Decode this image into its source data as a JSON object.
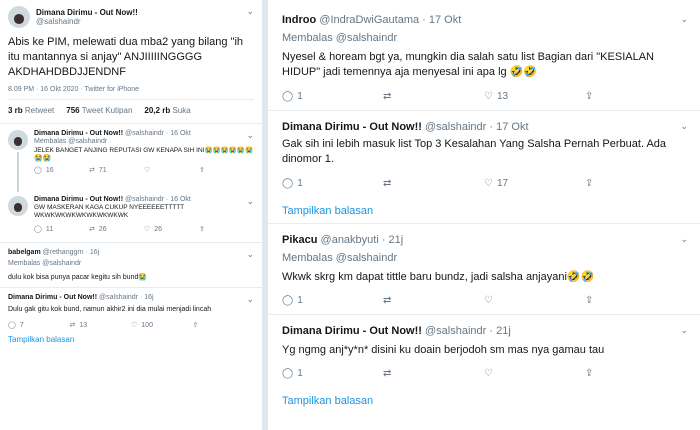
{
  "left": {
    "main": {
      "name": "Dimana Dirimu - Out Now!!",
      "handle": "@salshaindr",
      "text": "Abis ke PIM, melewati dua mba2 yang bilang \"ih itu mantannya si anjay\" ANJIIIIINGGGG AKDHAHDBDJJENDNF",
      "meta": "8.09 PM · 16 Okt 2020 · Twitter for iPhone",
      "stats": [
        {
          "value": "3 rb",
          "label": "Retweet"
        },
        {
          "value": "756",
          "label": "Tweet Kutipan"
        },
        {
          "value": "20,2 rb",
          "label": "Suka"
        }
      ]
    },
    "replies": [
      {
        "name": "Dimana Dirimu - Out Now!!",
        "handle": "@salshaindr · 16 Okt",
        "reply_to": "Membalas @salshaindr",
        "text": "JELEK BANGET ANJING REPUTASI GW KENAPA SIH INI😭😭😭😭😭😭",
        "text2": "😭😭",
        "reply": "16",
        "rt": "71",
        "like": ""
      },
      {
        "name": "Dimana Dirimu - Out Now!!",
        "handle": "@salshaindr · 16 Okt",
        "text": "GW MASKERAN KAGA CUKUP NYEEEEEETTTTT WKWKWKWKWKWKWKWKWK",
        "reply": "11",
        "rt": "26",
        "like": "26"
      },
      {
        "name": "babelgam",
        "handle": "@rethanggrn · 16j",
        "reply_to": "Membalas @salshaindr",
        "text": "dulu kok bisa punya pacar kegitu sih bund😭"
      },
      {
        "name": "Dimana Dirimu - Out Now!!",
        "handle": "@salshaindr · 16j",
        "text": "Dulu gak gitu kok bund, namun akhir2 ini dia mulai menjadi lincah",
        "reply": "7",
        "rt": "13",
        "like": "100"
      }
    ],
    "show_replies": "Tampilkan balasan"
  },
  "right": {
    "tweets": [
      {
        "name": "Indroo",
        "handle": "@IndraDwiGautama · 17 Okt",
        "reply_to": "Membalas @salshaindr",
        "text": "Nyesel & hoream bgt ya, mungkin dia salah satu list Bagian dari  \"KESIALAN HIDUP\"  jadi temennya aja menyesal ini apa lg 🤣🤣",
        "reply": "1",
        "rt": "",
        "like": "13"
      },
      {
        "name": "Dimana Dirimu - Out Now!!",
        "handle": "@salshaindr · 17 Okt",
        "text": "Gak sih ini lebih masuk list Top 3 Kesalahan Yang Salsha Pernah Perbuat. Ada dinomor 1.",
        "reply": "1",
        "rt": "",
        "like": "17",
        "show_replies": "Tampilkan balasan"
      },
      {
        "name": "Pikacu",
        "handle": "@anakbyuti · 21j",
        "reply_to": "Membalas @salshaindr",
        "text": "Wkwk skrg km dapat tittle baru bundz, jadi salsha anjayani🤣🤣",
        "reply": "1",
        "rt": "",
        "like": ""
      },
      {
        "name": "Dimana Dirimu - Out Now!!",
        "handle": "@salshaindr · 21j",
        "text": "Yg ngmg anj*y*n* disini ku doain berjodoh sm mas nya gamau tau",
        "reply": "1",
        "rt": "",
        "like": "",
        "show_replies": "Tampilkan balasan"
      }
    ]
  },
  "colors": {
    "accent": "#1b95e0",
    "muted": "#657786",
    "divider": "#e6ecf0"
  },
  "icons": [
    "reply-icon",
    "retweet-icon",
    "like-icon",
    "share-icon",
    "chevron-down-icon"
  ]
}
